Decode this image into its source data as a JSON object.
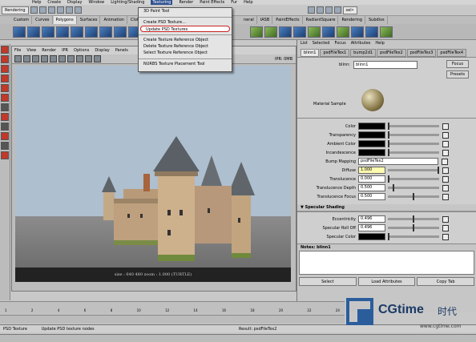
{
  "menubar": [
    "Help",
    "Create",
    "Display",
    "Window",
    "Lighting/Shading",
    "Texturing",
    "Render",
    "Paint Effects",
    "Fur",
    "Help"
  ],
  "toolbar": {
    "mode": "Rendering",
    "sel": "sel•"
  },
  "shelf_tabs": [
    "Custom",
    "Curves",
    "Polygons",
    "Surfaces",
    "Animation",
    "Cloth",
    "neral",
    "IASB",
    "PaintEffects",
    "RadiantSquare",
    "Rendering",
    "Subdivs"
  ],
  "texturing_menu": {
    "items": [
      "3D Paint Tool",
      "Create PSD Texture...",
      "Update PSD Textures",
      "Create Texture Reference Object",
      "Delete Texture Reference Object",
      "Select Texture Reference Object",
      "NURBS Texture Placement Tool"
    ],
    "selected": "Update PSD Textures"
  },
  "render_view": {
    "menu": [
      "File",
      "View",
      "Render",
      "IPR",
      "Options",
      "Display",
      "Panels"
    ],
    "ipr": "IPR: 0MB",
    "status": "size : 640 480 zoom : 1.000 (TURTLE)"
  },
  "attr_editor": {
    "menu": [
      "List",
      "Selected",
      "Focus",
      "Attributes",
      "Help"
    ],
    "tabs": [
      "blinn1",
      "psdFileTex1",
      "bump2d1",
      "psdFileTex2",
      "psdFileTex3",
      "psdFileTex4"
    ],
    "node_label": "blinn:",
    "node_value": "blinn1",
    "focus": "Focus",
    "presets": "Presets",
    "material_sample": "Material Sample",
    "attrs": [
      {
        "label": "Color",
        "kind": "swatch"
      },
      {
        "label": "Transparency",
        "kind": "swatch"
      },
      {
        "label": "Ambient Color",
        "kind": "swatch"
      },
      {
        "label": "Incandescence",
        "kind": "swatch"
      },
      {
        "label": "Bump Mapping",
        "kind": "text",
        "value": "psdFileTex2"
      },
      {
        "label": "Diffuse",
        "kind": "value",
        "value": "1.000",
        "level": 1.0,
        "highlight": true
      },
      {
        "label": "Translucence",
        "kind": "value",
        "value": "0.000",
        "level": 0.0
      },
      {
        "label": "Translucence Depth",
        "kind": "value",
        "value": "0.500",
        "level": 0.1
      },
      {
        "label": "Translucence Focus",
        "kind": "value",
        "value": "0.500",
        "level": 0.5
      }
    ],
    "specular_section": "Specular Shading",
    "spec_attrs": [
      {
        "label": "Eccentricity",
        "kind": "value",
        "value": "0.496",
        "level": 0.5
      },
      {
        "label": "Specular Roll Off",
        "kind": "value",
        "value": "0.496",
        "level": 0.5
      },
      {
        "label": "Specular Color",
        "kind": "swatch"
      }
    ],
    "notes": "Notes: blinn1",
    "buttons": [
      "Select",
      "Load Attributes",
      "Copy Tab"
    ]
  },
  "timeline_ticks": [
    "1",
    "2",
    "4",
    "6",
    "8",
    "10",
    "12",
    "14",
    "16",
    "18",
    "20",
    "22",
    "24"
  ],
  "command_line": "PSD Texture",
  "command_output": "Update PSD texture nodes",
  "result": "Result: psdFileTex2",
  "watermark": {
    "brand": "CGtime",
    "cn": "时代",
    "url": "www.cgtime.com"
  },
  "colors": {
    "menu_highlight": "#cc2222",
    "viewport_sky": "#aebfcf",
    "diffuse_field": "#fffbb0"
  }
}
